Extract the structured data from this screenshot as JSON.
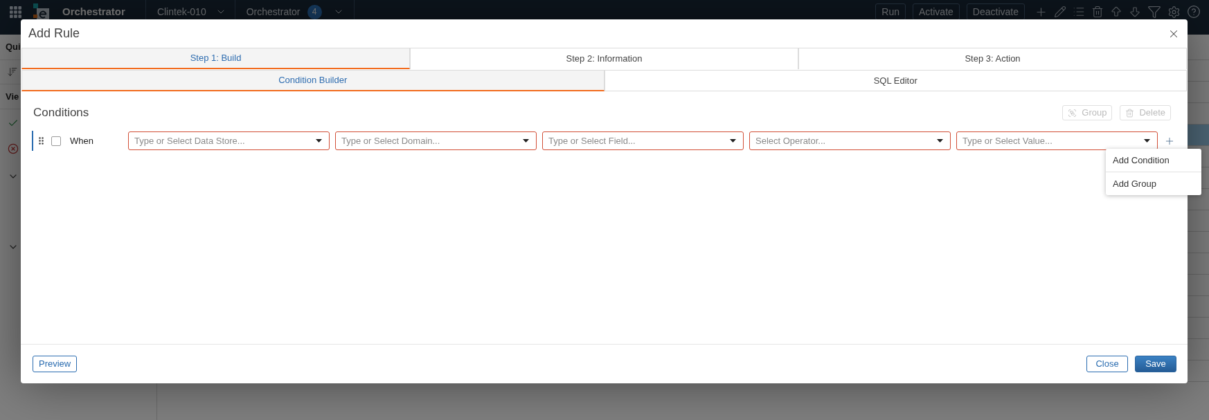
{
  "app_header": {
    "app_name": "Orchestrator",
    "workspace": "Clintek-010",
    "module": "Orchestrator",
    "module_count": "4",
    "buttons": [
      "Run",
      "Activate",
      "Deactivate"
    ]
  },
  "sidebar": {
    "sections": [
      {
        "title": "Qui"
      },
      {
        "title": "Vie"
      }
    ]
  },
  "background_table": {
    "rows": [
      {
        "selected": false
      },
      {
        "selected": false
      },
      {
        "selected": false
      },
      {
        "selected": true
      },
      {
        "selected": false
      },
      {
        "selected": false
      },
      {
        "selected": false
      },
      {
        "selected": false
      },
      {
        "selected": false
      },
      {
        "selected": false
      },
      {
        "selected": false
      },
      {
        "selected": false
      },
      {
        "selected": false
      },
      {
        "selected": false
      },
      {
        "selected": false
      }
    ]
  },
  "dialog": {
    "title": "Add Rule",
    "steps": [
      {
        "label": "Step 1: Build",
        "selected": true
      },
      {
        "label": "Step 2: Information",
        "selected": false
      },
      {
        "label": "Step 3: Action",
        "selected": false
      }
    ],
    "editor_tabs": [
      {
        "label": "Condition Builder",
        "selected": true
      },
      {
        "label": "SQL Editor",
        "selected": false
      }
    ],
    "conditions": {
      "title": "Conditions",
      "actions": [
        {
          "kind": "group",
          "label": "Group",
          "disabled": true
        },
        {
          "kind": "delete",
          "label": "Delete",
          "disabled": true
        }
      ],
      "rows": [
        {
          "checked": false,
          "label": "When",
          "fields": [
            {
              "placeholder": "Type or Select Data Store..."
            },
            {
              "placeholder": "Type or Select Domain..."
            },
            {
              "placeholder": "Type or Select Field..."
            },
            {
              "placeholder": "Select Operator..."
            },
            {
              "placeholder": "Type or Select Value..."
            }
          ]
        }
      ]
    },
    "add_menu": {
      "items": [
        "Add Condition",
        "Add Group"
      ]
    },
    "footer": {
      "left": [
        {
          "label": "Preview",
          "kind": "outline"
        }
      ],
      "right": [
        {
          "label": "Close",
          "kind": "outline"
        },
        {
          "label": "Save",
          "kind": "primary"
        }
      ]
    }
  }
}
